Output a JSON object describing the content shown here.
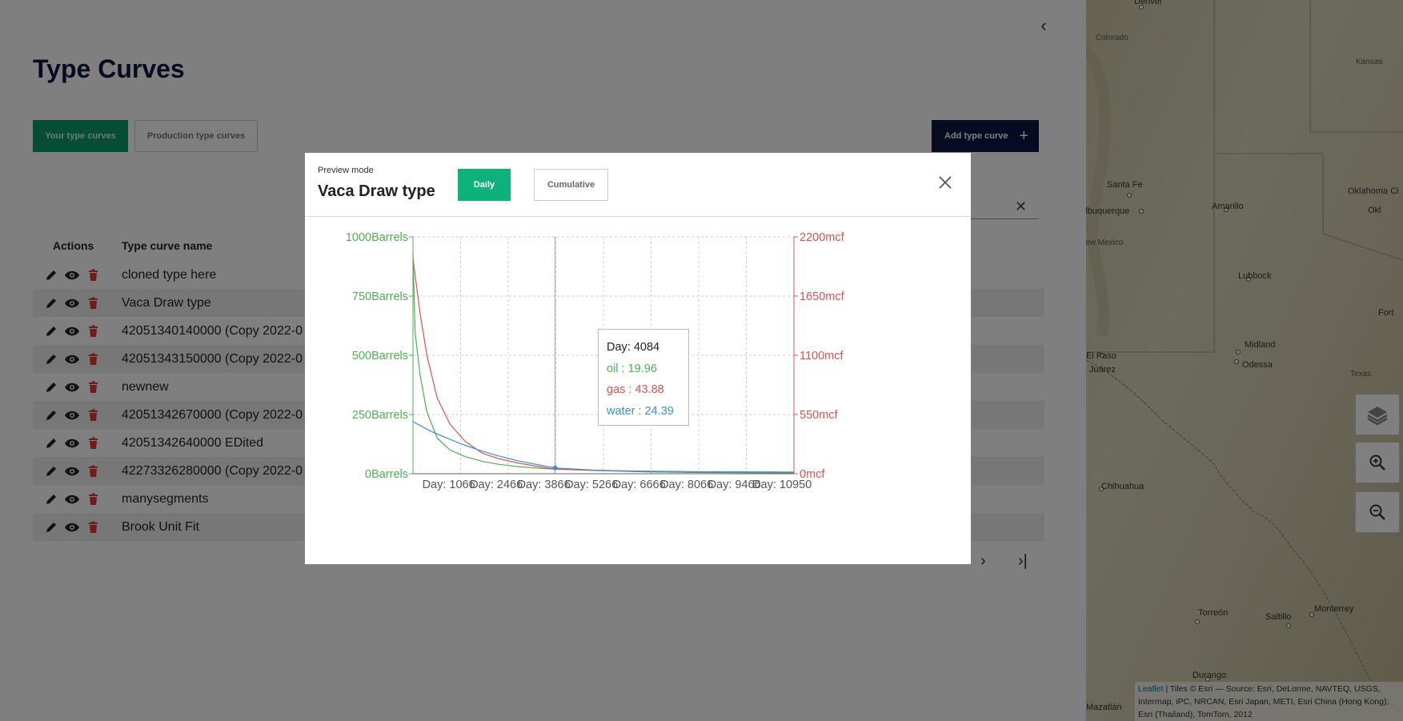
{
  "app": {
    "page_title": "Type Curves",
    "tabs": [
      "Your type curves",
      "Production type curves"
    ],
    "add_button_label": "Add type curve",
    "table": {
      "headers": {
        "actions": "Actions",
        "name": "Type curve name"
      },
      "rows": [
        "cloned type here",
        "Vaca Draw type",
        "42051340140000 (Copy 2022-0",
        "42051343150000 (Copy 2022-0",
        "newnew",
        "42051342670000 (Copy 2022-0",
        "42051342640000 EDited",
        "42273326280000 (Copy 2022-0",
        "manysegments",
        "Brook Unit Fit"
      ]
    }
  },
  "map": {
    "labels": [
      "Colorado",
      "Kansas",
      "Santa Fe",
      "Albuquerque",
      "Amarillo",
      "Oklahoma Ci",
      "Okl",
      "New Mexico",
      "Lubbock",
      "Fort",
      "Midland",
      "Odessa",
      "El Paso",
      "Juárez",
      "Texas",
      "A",
      "Chihuahua",
      "Torreón",
      "Saltillo",
      "Monterrey",
      "Durango",
      "Mazatlán",
      "Denver"
    ],
    "attribution": {
      "link": "Leaflet",
      "text": "| Tiles © Esri — Source: Esri, DeLorme, NAVTEQ, USGS, Intermap, iPC, NRCAN, Esri Japan, METI, Esri China (Hong Kong), Esri (Thailand), TomTom, 2012"
    }
  },
  "modal": {
    "preview_label": "Preview mode",
    "title": "Vaca Draw type",
    "modes": [
      "Daily",
      "Cumulative"
    ],
    "tooltip": {
      "day": "Day: 4084",
      "oil": "oil : 19.96",
      "gas": "gas : 43.88",
      "water": "water : 24.39"
    }
  },
  "colors": {
    "oil": "#4caf50",
    "gas": "#e05050",
    "water": "#3a8fd0",
    "primary_green": "#0db27a",
    "navy": "#0b1640"
  },
  "chart_data": {
    "type": "line",
    "x_tick_labels": [
      "Day: 1066",
      "Day: 2466",
      "Day: 3866",
      "Day: 5266",
      "Day: 6666",
      "Day: 8066",
      "Day: 9466",
      "Day: 10950"
    ],
    "xlim": [
      0,
      10950
    ],
    "left_axis": {
      "unit": "Barrels",
      "ticks": [
        "1000Barrels",
        "750Barrels",
        "500Barrels",
        "250Barrels",
        "0Barrels"
      ],
      "ylim": [
        0,
        1000
      ]
    },
    "right_axis": {
      "unit": "mcf",
      "ticks": [
        "2200mcf",
        "1650mcf",
        "1100mcf",
        "550mcf",
        "0mcf"
      ],
      "ylim": [
        0,
        2200
      ]
    },
    "grid": true,
    "cursor_day": 4084,
    "series": [
      {
        "name": "oil",
        "axis": "left",
        "x": [
          0,
          60,
          200,
          400,
          700,
          1066,
          1500,
          2000,
          2466,
          3000,
          3866,
          4084,
          5266,
          6666,
          8066,
          9466,
          10950
        ],
        "y": [
          930,
          600,
          420,
          260,
          150,
          100,
          72,
          52,
          40,
          30,
          21,
          19.96,
          14,
          11,
          9,
          8,
          7
        ]
      },
      {
        "name": "gas",
        "axis": "right",
        "x": [
          0,
          60,
          200,
          400,
          700,
          1066,
          1500,
          2000,
          2466,
          3000,
          3866,
          4084,
          5266,
          6666,
          8066,
          9466,
          10950
        ],
        "y": [
          2000,
          1850,
          1500,
          1100,
          700,
          460,
          300,
          190,
          140,
          100,
          52,
          43.88,
          30,
          18,
          12,
          10,
          8
        ]
      },
      {
        "name": "water",
        "axis": "left",
        "x": [
          0,
          500,
          1066,
          1500,
          2000,
          2466,
          3000,
          3866,
          4084,
          5266,
          6666,
          8066,
          9466,
          10950
        ],
        "y": [
          220,
          180,
          145,
          120,
          95,
          75,
          55,
          30,
          24.39,
          15,
          9,
          6,
          5,
          4
        ]
      }
    ]
  }
}
